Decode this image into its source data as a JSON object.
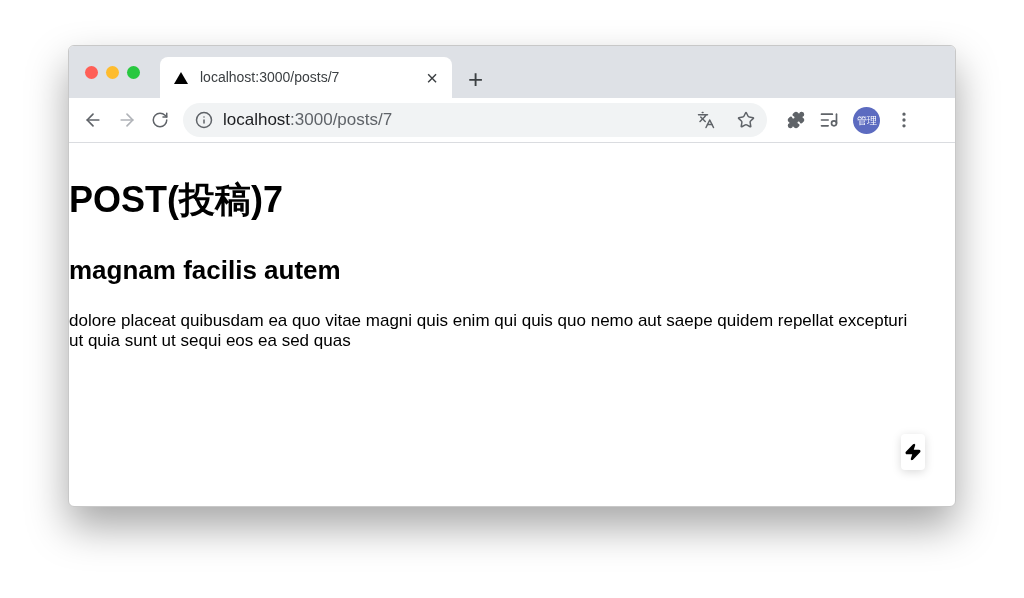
{
  "tab": {
    "title": "localhost:3000/posts/7",
    "close": "×",
    "selected": true
  },
  "new_tab": "+",
  "toolbar": {
    "back": {
      "disabled": false
    },
    "forward": {
      "disabled": true
    }
  },
  "address": {
    "host": "localhost",
    "path": ":3000/posts/7"
  },
  "profile": {
    "label": "管理"
  },
  "page": {
    "title": "POST(投稿)7",
    "subtitle": "magnam facilis autem",
    "body": "dolore placeat quibusdam ea quo vitae magni quis enim qui quis quo nemo aut saepe quidem repellat excepturi ut quia sunt ut sequi eos ea sed quas"
  }
}
